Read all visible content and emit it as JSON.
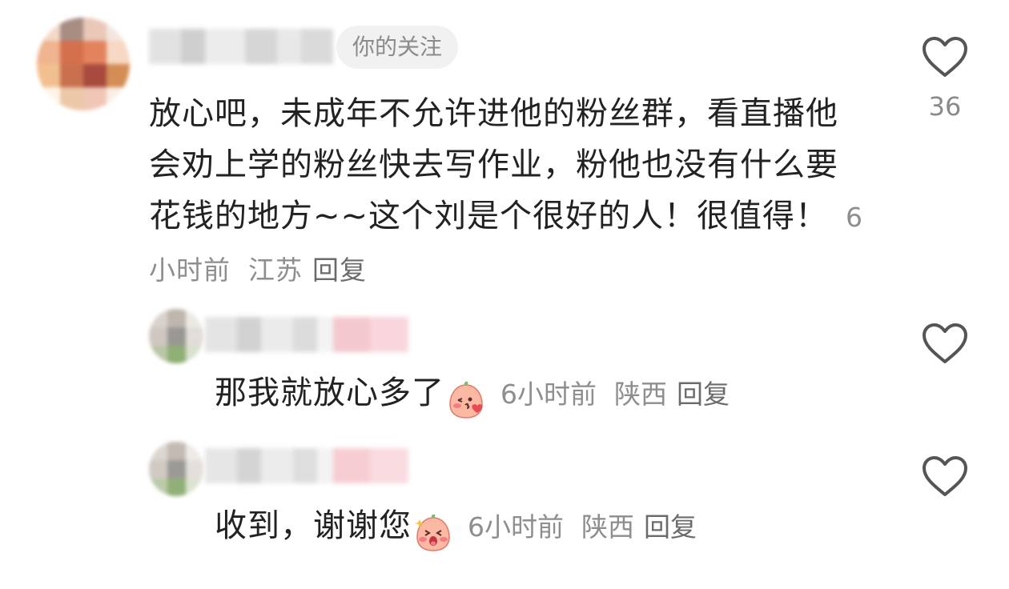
{
  "comment": {
    "tag": "你的关注",
    "text": "放心吧，未成年不允许进他的粉丝群，看直播他会劝上学的粉丝快去写作业，粉他也没有什么要花钱的地方~~这个刘是个很好的人！很值得！",
    "time": "6小时前",
    "location": "江苏",
    "reply_label": "回复",
    "like_count": "36",
    "like_icon": "heart-outline-icon"
  },
  "replies": [
    {
      "text": "那我就放心多了",
      "emoji": "blush-kiss-emoji",
      "time": "6小时前",
      "location": "陕西",
      "reply_label": "回复",
      "like_icon": "heart-outline-icon"
    },
    {
      "text": "收到，谢谢您",
      "emoji": "excited-emoji",
      "time": "6小时前",
      "location": "陕西",
      "reply_label": "回复",
      "like_icon": "heart-outline-icon"
    }
  ],
  "colors": {
    "text": "#222222",
    "meta": "#8e8e8e",
    "tag_bg": "#f1f1f1",
    "icon": "#555555"
  }
}
